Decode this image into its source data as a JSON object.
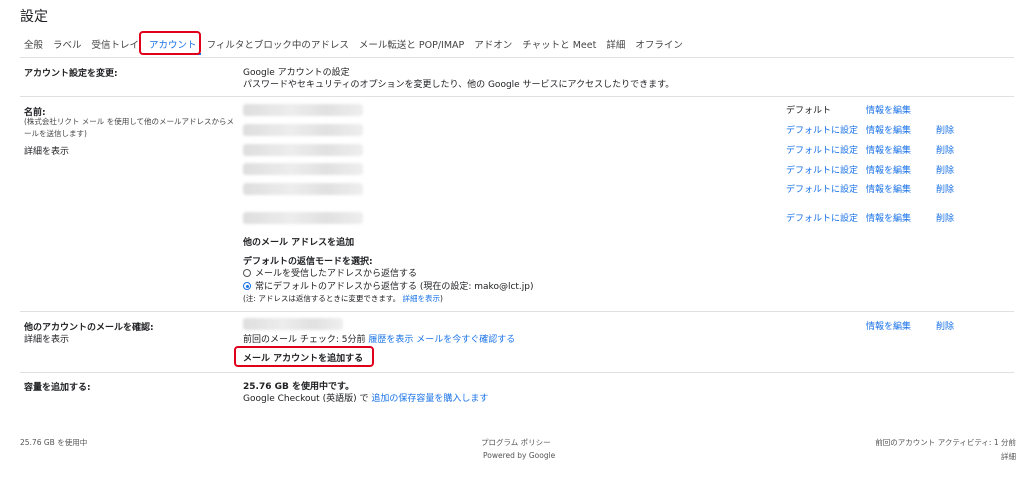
{
  "page_title": "設定",
  "tabs": [
    "全般",
    "ラベル",
    "受信トレイ",
    "アカウント",
    "フィルタとブロック中のアドレス",
    "メール転送と POP/IMAP",
    "アドオン",
    "チャットと Meet",
    "詳細",
    "オフライン"
  ],
  "active_tab_index": 3,
  "account_settings": {
    "label": "アカウント設定を変更:",
    "link": "Google アカウントの設定",
    "desc": "パスワードやセキュリティのオプションを変更したり、他の Google サービスにアクセスしたりできます。"
  },
  "name_section": {
    "label": "名前:",
    "desc": "(株式会社リクト メール を使用して他のメールアドレスからメールを送信します)",
    "details_link": "詳細を表示",
    "rows": [
      {
        "default_text": "デフォルト",
        "edit": "情報を編集",
        "delete": ""
      },
      {
        "default_text": "デフォルトに設定",
        "edit": "情報を編集",
        "delete": "削除"
      },
      {
        "default_text": "デフォルトに設定",
        "edit": "情報を編集",
        "delete": "削除"
      },
      {
        "default_text": "デフォルトに設定",
        "edit": "情報を編集",
        "delete": "削除"
      },
      {
        "default_text": "デフォルトに設定",
        "edit": "情報を編集",
        "delete": "削除"
      },
      {
        "default_text": "デフォルトに設定",
        "edit": "情報を編集",
        "delete": "削除"
      }
    ],
    "add_address_link": "他のメール アドレスを追加",
    "reply_mode_title": "デフォルトの返信モードを選択:",
    "reply_option_1": "メールを受信したアドレスから返信する",
    "reply_option_2": "常にデフォルトのアドレスから返信する (現在の設定: mako@lct.jp)",
    "reply_note": "(注: アドレスは返信するときに変更できます。",
    "reply_note_link": "詳細を表示",
    "reply_note_end": ")"
  },
  "check_mail": {
    "label": "他のアカウントのメールを確認:",
    "details_link": "詳細を表示",
    "last_check": "前回のメール チェック: 5分前",
    "history_link": "履歴を表示",
    "check_now_link": "メールを今すぐ確認する",
    "add_account_link": "メール アカウントを追加する",
    "edit": "情報を編集",
    "delete": "削除"
  },
  "storage": {
    "label": "容量を追加する:",
    "usage": "25.76 GB を使用中です。",
    "checkout_prefix": "Google Checkout (英語版) で",
    "buy_link": "追加の保存容量を購入します"
  },
  "footer": {
    "usage": "25.76 GB を使用中",
    "policy": "プログラム ポリシー",
    "powered": "Powered by Google",
    "activity": "前回のアカウント アクティビティ: 1 分前",
    "details": "詳細"
  }
}
